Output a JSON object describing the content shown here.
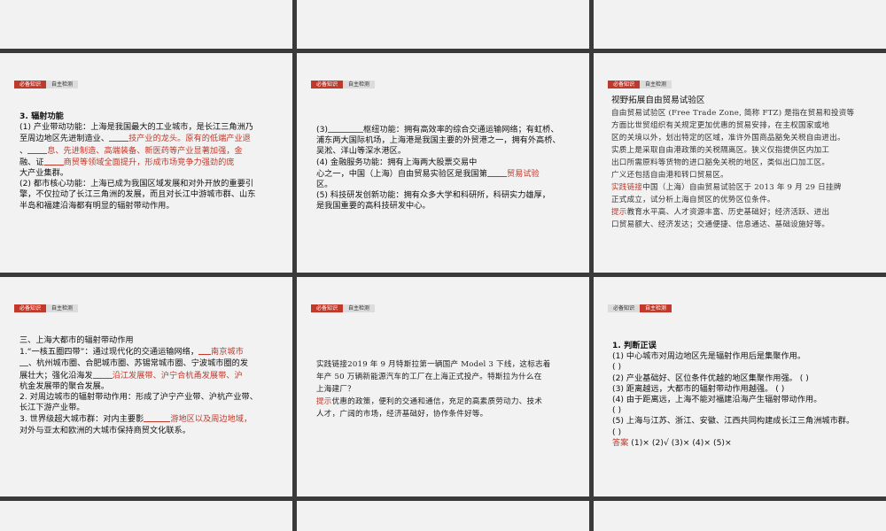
{
  "tabs": {
    "bibei": "必备知识",
    "zizhu": "自主检测"
  },
  "s1": {
    "heading": "3. 辐射功能",
    "lines": [
      "(1) 产业带动功能：上海是我国最大的工业城市，是长江三角洲乃",
      "至周边地区先进制造业、",
      "技产业的龙头。原有的低端产业退",
      "、",
      "息、先进制造、高端装备、新医药等产业显著加强，金",
      "融、证",
      "商贸等领域全面提升，形成市场竞争力强劲的庞",
      "大产业集群。",
      "(2) 都市核心功能：上海已成为我国区域发展和对外开放的重要引",
      "擎，不仅拉动了长江三角洲的发展，而且对长江中游城市群、山东",
      "半岛和福建沿海都有明显的辐射带动作用。"
    ]
  },
  "s2": {
    "lines": [
      "(3)",
      "枢纽功能：拥有高效率的综合交通运输网络；有虹桥、",
      "浦东两大国际机场，上海港是我国主要的外贸港之一，拥有外高桥、",
      "吴淞、洋山等深水港区。",
      "(4) 金融服务功能：拥有上海两大股票交易中",
      "心之一，中国（上海）自由贸易实验区是我国第",
      "贸易试验",
      "区。",
      "(5) 科技研发创新功能：拥有众多大学和科研所，科研实力雄厚，",
      "是我国重要的高科技研发中心。"
    ]
  },
  "s3": {
    "title": "视野拓展自由贸易试验区",
    "para": [
      "自由贸易试验区 (Free Trade Zone, 简称 FTZ) 是指在贸易和投资等",
      "方面比世贸组织有关规定更加优惠的贸易安排，在主权国家或地",
      "区的关境以外，划出特定的区域，准许外国商品豁免关税自由进出。",
      "实质上是采取自由港政策的关税隔离区。狭义仅指提供区内加工",
      "出口所需原料等货物的进口豁免关税的地区，类似出口加工区。",
      "广义还包括自由港和转口贸易区。"
    ],
    "link_label": "实践链接",
    "link_text": "中国（上海）自由贸易试验区于 2013 年 9 月 29 日挂牌",
    "link_text2": "正式成立，试分析上海自贸区的优势区位条件。",
    "hint_label": "提示",
    "hint_text": "教育水平高、人才资源丰富、历史基础好；经济活跃、进出",
    "hint_text2": "口贸易额大、经济发达；交通便捷、信息通达、基础设施好等。"
  },
  "s4": {
    "heading": "三、上海大都市的辐射带动作用",
    "lines": [
      "1.“一核五圈四带”：通过现代化的交通运输网络，",
      "南京城市",
      "、杭州城市圈、合肥城市圈、苏锡常城市圈、宁波城市圈的发",
      "展壮大；强化沿海发",
      "沿江发展带、沪宁合杭甬发展带、沪",
      "杭金发展带的聚合发展。",
      "2. 对周边城市的辐射带动作用：形成了沪宁产业带、沪杭产业带、",
      "长江下游产业带。",
      "3. 世界级超大城市群：对内主要影",
      "游地区以及周边地域，",
      "对外与亚太和欧洲的大城市保持商贸文化联系。"
    ]
  },
  "s5": {
    "label": "实践链接",
    "text1": "2019 年 9 月特斯拉第一辆国产 Model 3 下线，这标志着",
    "text2": "年产 50 万辆新能源汽车的工厂在上海正式投产。特斯拉为什么在",
    "text3": "上海建厂？",
    "hint_label": "提示",
    "hint1": "优惠的政策，便利的交通和通信，充足的高素质劳动力、技术",
    "hint2": "人才，广阔的市场，经济基础好，协作条件好等。"
  },
  "s6": {
    "heading": "1. 判断正误",
    "q1": "(1) 中心城市对周边地区先是辐射作用后是集聚作用。",
    "q1b": "(       )",
    "q2": "(2) 产业基础好、区位条件优越的地区集聚作用强。    (       )",
    "q3": "(3) 距离越远，大都市的辐射带动作用越强。    (       )",
    "q4": "(4) 由于距离远，上海不能对福建沿海产生辐射带动作用。",
    "q4b": "(       )",
    "q5": "(5) 上海与江苏、浙江、安徽、江西共同构建成长江三角洲城市群。",
    "q5b": "(       )",
    "answer_label": "答案",
    "answer_text": "(1)×    (2)√    (3)×    (4)×    (5)×"
  },
  "colors": {
    "accent": "#c0392b",
    "slide_bg": "#f2f2f2",
    "page_bg": "#3a3a3a"
  }
}
